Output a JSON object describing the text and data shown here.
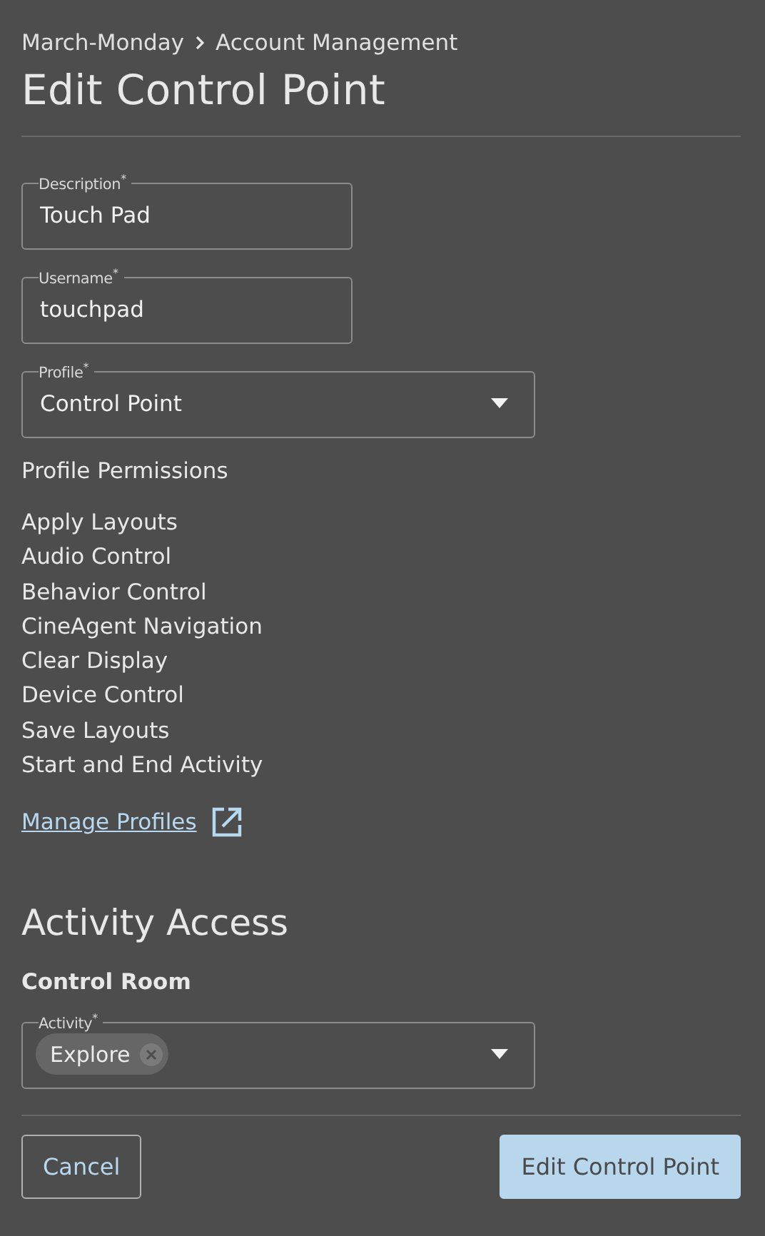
{
  "breadcrumb": [
    "March-Monday",
    "Account Management"
  ],
  "title": "Edit Control Point",
  "fields": [
    {
      "kind": "text",
      "label": "Description$^{*}$",
      "value": "Touch Pad"
    },
    {
      "kind": "text",
      "label": "Username$^{*}$",
      "value": "touchpad"
    },
    {
      "kind": "select",
      "label": "Profile$^{*}$",
      "value": "Control Point"
    }
  ],
  "permissions_heading": "Profile Permissions",
  "permissions": [
    "Apply Layouts",
    "Audio Control",
    "Behavior Control",
    "CineAgent Navigation",
    "Clear Display",
    "Device Control",
    "Save Layouts",
    "Start and End Activity"
  ],
  "manage_link": "Manage Profiles",
  "section_title": "Activity Access",
  "subsection": "Control Room",
  "activity_field": {
    "label": "Activity$^{*}$",
    "chips": [
      "Explore"
    ]
  },
  "buttons": [
    {
      "kind": "secondary",
      "label": "Cancel"
    },
    {
      "kind": "primary",
      "label": "Edit Control Point"
    }
  ]
}
